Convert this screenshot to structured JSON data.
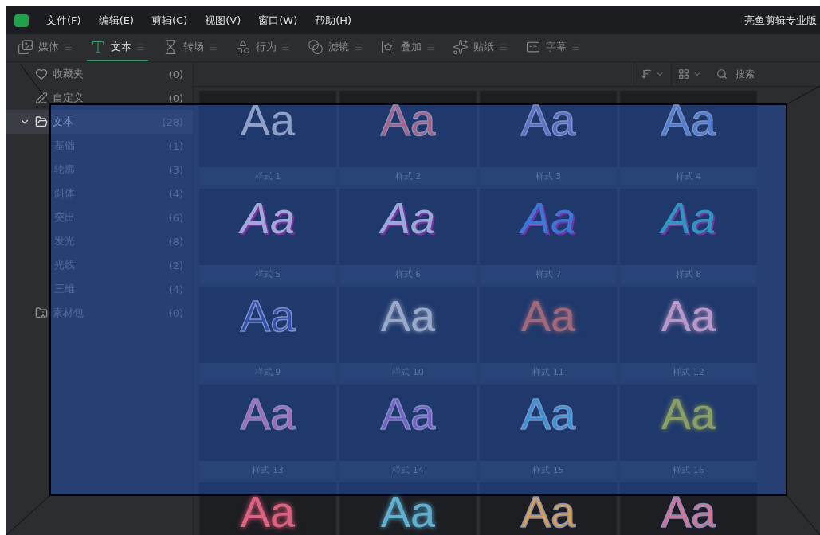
{
  "menu_bar": {
    "items": [
      "文件(F)",
      "编辑(E)",
      "剪辑(C)",
      "视图(V)",
      "窗口(W)",
      "帮助(H)"
    ],
    "app_title": "亮鱼剪辑专业版"
  },
  "tabs": [
    {
      "label": "媒体",
      "selected": false
    },
    {
      "label": "文本",
      "selected": true
    },
    {
      "label": "转场",
      "selected": false
    },
    {
      "label": "行为",
      "selected": false
    },
    {
      "label": "滤镜",
      "selected": false
    },
    {
      "label": "叠加",
      "selected": false
    },
    {
      "label": "贴纸",
      "selected": false
    },
    {
      "label": "字幕",
      "selected": false
    }
  ],
  "sidebar": {
    "items": [
      {
        "label": "收藏夹",
        "count": "(0)",
        "selected": false
      },
      {
        "label": "自定义",
        "count": "(0)",
        "selected": false
      },
      {
        "label": "文本",
        "count": "(28)",
        "selected": true,
        "expanded": true,
        "children": [
          {
            "label": "基础",
            "count": "(1)",
            "selected": false
          },
          {
            "label": "轮廓",
            "count": "(3)",
            "selected": false
          },
          {
            "label": "斜体",
            "count": "(4)",
            "selected": false
          },
          {
            "label": "突出",
            "count": "(6)",
            "selected": false
          },
          {
            "label": "发光",
            "count": "(8)",
            "selected": false
          },
          {
            "label": "光线",
            "count": "(2)",
            "selected": false
          },
          {
            "label": "三维",
            "count": "(4)",
            "selected": false
          }
        ]
      },
      {
        "label": "素材包",
        "count": "(0)",
        "selected": false
      }
    ]
  },
  "search": {
    "placeholder": "搜索"
  },
  "styles": [
    {
      "preview": "Aa",
      "label": "样式 1",
      "kind": "plain",
      "color": "#8fa0c8"
    },
    {
      "preview": "Aa",
      "label": "样式 2",
      "kind": "outline",
      "color": "#b0607e"
    },
    {
      "preview": "Aa",
      "label": "样式 3",
      "kind": "outline",
      "color": "#5a70c8"
    },
    {
      "preview": "Aa",
      "label": "样式 4",
      "kind": "outline",
      "color": "#4a80d8"
    },
    {
      "preview": "Aa",
      "label": "样式 5",
      "kind": "italic",
      "color": "#a0a8d8"
    },
    {
      "preview": "Aa",
      "label": "样式 6",
      "kind": "italic",
      "color": "#98a8d8"
    },
    {
      "preview": "Aa",
      "label": "样式 7",
      "kind": "italic",
      "color": "#3a78d8"
    },
    {
      "preview": "Aa",
      "label": "样式 8",
      "kind": "italic",
      "color": "#2a98c0"
    },
    {
      "preview": "Aa",
      "label": "样式 9",
      "kind": "outline",
      "color": "#3050b0"
    },
    {
      "preview": "Aa",
      "label": "样式 10",
      "kind": "glow",
      "color": "#98a8c8"
    },
    {
      "preview": "Aa",
      "label": "样式 11",
      "kind": "glow",
      "color": "#a06878"
    },
    {
      "preview": "Aa",
      "label": "样式 12",
      "kind": "glow",
      "color": "#b898c8"
    },
    {
      "preview": "Aa",
      "label": "样式 13",
      "kind": "outline",
      "color": "#a868b8"
    },
    {
      "preview": "Aa",
      "label": "样式 14",
      "kind": "outline",
      "color": "#7860c8"
    },
    {
      "preview": "Aa",
      "label": "样式 15",
      "kind": "outline",
      "color": "#3098d8"
    },
    {
      "preview": "Aa",
      "label": "样式 16",
      "kind": "glow",
      "color": "#8aa060"
    },
    {
      "preview": "Aa",
      "kind": "glow",
      "color": "#e06080"
    },
    {
      "preview": "Aa",
      "kind": "glow",
      "color": "#60b0d0"
    },
    {
      "preview": "Aa",
      "kind": "outline",
      "color": "#e0a040"
    },
    {
      "preview": "Aa",
      "kind": "outline",
      "color": "#e07090"
    }
  ]
}
